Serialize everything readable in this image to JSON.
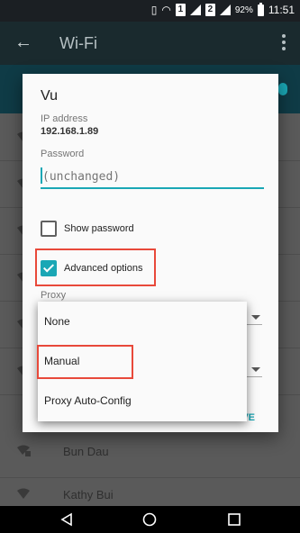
{
  "status_bar": {
    "sim1": "1",
    "sim2": "2",
    "battery": "92%",
    "time": "11:51"
  },
  "app_bar": {
    "title": "Wi-Fi"
  },
  "background_list": {
    "items": [
      {
        "name": ""
      },
      {
        "name": ""
      },
      {
        "name": ""
      },
      {
        "name": ""
      },
      {
        "name": ""
      },
      {
        "name": ""
      },
      {
        "name": "Bun Dau"
      },
      {
        "name": "Kathy Bui"
      }
    ]
  },
  "dialog": {
    "network_name": "Vu",
    "ip_label": "IP address",
    "ip_value": "192.168.1.89",
    "password_label": "Password",
    "password_placeholder": "(unchanged)",
    "show_password_label": "Show password",
    "show_password_checked": false,
    "advanced_options_label": "Advanced options",
    "advanced_options_checked": true,
    "proxy_label": "Proxy",
    "save_label": "SAVE"
  },
  "proxy_dropdown": {
    "options": [
      "None",
      "Manual",
      "Proxy Auto-Config"
    ],
    "highlighted": "Manual"
  },
  "colors": {
    "accent": "#1aa7b5",
    "highlight_box": "#e8493a"
  }
}
